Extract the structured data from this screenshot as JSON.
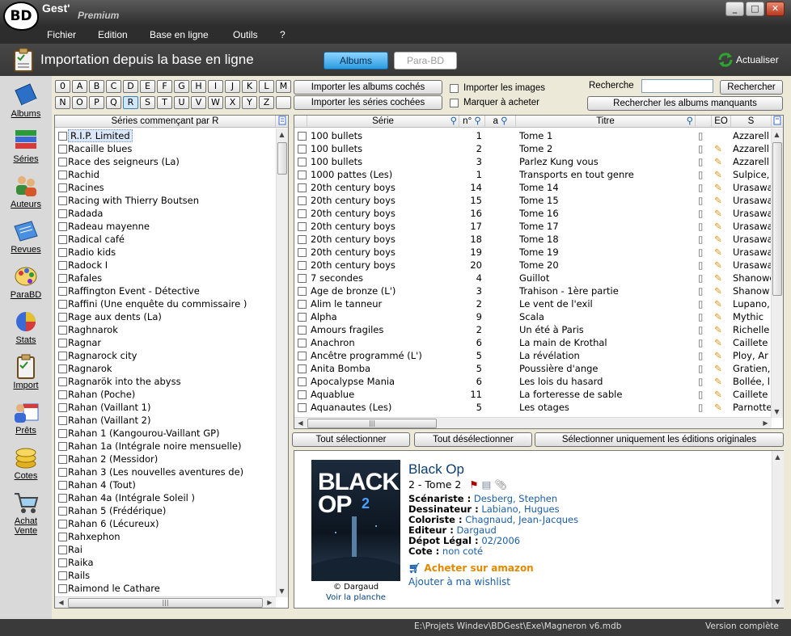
{
  "app": {
    "logo": "BD",
    "name": "Gest'",
    "edition": "Premium"
  },
  "window_buttons": [
    "minimize",
    "maximize",
    "close"
  ],
  "menu": [
    "Fichier",
    "Edition",
    "Base en ligne",
    "Outils",
    "?"
  ],
  "header": {
    "title": "Importation depuis la base en ligne",
    "tab_albums": "Albums",
    "tab_parabd": "Para-BD",
    "refresh": "Actualiser"
  },
  "sidebar": [
    {
      "label": "Albums",
      "icon": "book-icon"
    },
    {
      "label": "Séries",
      "icon": "books-stack-icon"
    },
    {
      "label": "Auteurs",
      "icon": "authors-icon"
    },
    {
      "label": "Revues",
      "icon": "magazine-icon"
    },
    {
      "label": "ParaBD",
      "icon": "palette-icon"
    },
    {
      "label": "Stats",
      "icon": "pie-chart-icon"
    },
    {
      "label": "Import",
      "icon": "clipboard-check-icon"
    },
    {
      "label": "Prêts",
      "icon": "calendar-person-icon"
    },
    {
      "label": "Cotes",
      "icon": "coins-icon"
    },
    {
      "label": "Achat\nVente",
      "icon": "shopping-cart-icon"
    }
  ],
  "letters_row1": [
    "0",
    "A",
    "B",
    "C",
    "D",
    "E",
    "F",
    "G",
    "H",
    "I",
    "J",
    "K",
    "L",
    "M"
  ],
  "letters_row2": [
    "N",
    "O",
    "P",
    "Q",
    "R",
    "S",
    "T",
    "U",
    "V",
    "W",
    "X",
    "Y",
    "Z",
    ""
  ],
  "active_letter": "R",
  "actions": {
    "import_albums": "Importer les albums cochés",
    "import_series": "Importer les séries cochées",
    "import_images": "Importer les images",
    "mark_to_buy": "Marquer à acheter",
    "search_label": "Recherche",
    "search_value": "",
    "search_button": "Rechercher",
    "search_missing": "Rechercher les albums manquants"
  },
  "series_panel": {
    "header": "Séries commençant par R",
    "items": [
      "R.I.P. Limited",
      "Racaille blues",
      "Race des seigneurs (La)",
      "Rachid",
      "Racines",
      "Racing with Thierry Boutsen",
      "Radada",
      "Radeau mayenne",
      "Radical café",
      "Radio kids",
      "Radock I",
      "Rafales",
      "Raffington Event - Détective",
      "Raffini (Une enquête du commissaire )",
      "Rage aux dents (La)",
      "Raghnarok",
      "Ragnar",
      "Ragnarock city",
      "Ragnarok",
      "Ragnarök into the abyss",
      "Rahan (Poche)",
      "Rahan (Vaillant 1)",
      "Rahan (Vaillant 2)",
      "Rahan 1 (Kangourou-Vaillant GP)",
      "Rahan 1a (Intégrale noire mensuelle)",
      "Rahan 2 (Messidor)",
      "Rahan 3 (Les nouvelles aventures de)",
      "Rahan 4 (Tout)",
      "Rahan 4a (Intégrale Soleil )",
      "Rahan 5 (Frédérique)",
      "Rahan 6 (Lécureux)",
      "Rahxephon",
      "Rai",
      "Raika",
      "Rails",
      "Raimond le Cathare"
    ]
  },
  "albums_panel": {
    "headers": {
      "serie": "Série",
      "num": "n°",
      "a": "a",
      "titre": "Titre",
      "eo": "EO",
      "s": "S"
    },
    "rows": [
      {
        "serie": "100 bullets",
        "num": "1",
        "titre": "Tome 1",
        "author": "Azzarell",
        "eo": false
      },
      {
        "serie": "100 bullets",
        "num": "2",
        "titre": "Tome 2",
        "author": "Azzarell",
        "eo": true
      },
      {
        "serie": "100 bullets",
        "num": "3",
        "titre": "Parlez Kung vous",
        "author": "Azzarell",
        "eo": true
      },
      {
        "serie": "1000 pattes (Les)",
        "num": "1",
        "titre": "Transports en tout genre",
        "author": "Sulpice,",
        "eo": true
      },
      {
        "serie": "20th century boys",
        "num": "14",
        "titre": "Tome 14",
        "author": "Urasawa",
        "eo": true
      },
      {
        "serie": "20th century boys",
        "num": "15",
        "titre": "Tome 15",
        "author": "Urasawa",
        "eo": true
      },
      {
        "serie": "20th century boys",
        "num": "16",
        "titre": "Tome 16",
        "author": "Urasawa",
        "eo": true
      },
      {
        "serie": "20th century boys",
        "num": "17",
        "titre": "Tome 17",
        "author": "Urasawa",
        "eo": true
      },
      {
        "serie": "20th century boys",
        "num": "18",
        "titre": "Tome 18",
        "author": "Urasawa",
        "eo": true
      },
      {
        "serie": "20th century boys",
        "num": "19",
        "titre": "Tome 19",
        "author": "Urasawa",
        "eo": true
      },
      {
        "serie": "20th century boys",
        "num": "20",
        "titre": "Tome 20",
        "author": "Urasawa",
        "eo": true
      },
      {
        "serie": "7 secondes",
        "num": "4",
        "titre": "Guillot",
        "author": "Shanower",
        "eo": true
      },
      {
        "serie": "Age de bronze (L')",
        "num": "3",
        "titre": "Trahison - 1ère partie",
        "author": "Shanow",
        "eo": true
      },
      {
        "serie": "Alim le tanneur",
        "num": "2",
        "titre": "Le vent de l'exil",
        "author": "Lupano,",
        "eo": true
      },
      {
        "serie": "Alpha",
        "num": "9",
        "titre": "Scala",
        "author": "Mythic",
        "eo": true
      },
      {
        "serie": "Amours fragiles",
        "num": "2",
        "titre": "Un été à Paris",
        "author": "Richelle",
        "eo": true
      },
      {
        "serie": "Anachron",
        "num": "6",
        "titre": "La main de Krothal",
        "author": "Caillete",
        "eo": true
      },
      {
        "serie": "Ancêtre programmé (L')",
        "num": "5",
        "titre": "La révélation",
        "author": "Ploy, Ar",
        "eo": true
      },
      {
        "serie": "Anita Bomba",
        "num": "5",
        "titre": "Poussière d'ange",
        "author": "Gratien,",
        "eo": true
      },
      {
        "serie": "Apocalypse Mania",
        "num": "6",
        "titre": "Les lois du hasard",
        "author": "Bollée, l",
        "eo": true
      },
      {
        "serie": "Aquablue",
        "num": "11",
        "titre": "La forteresse de sable",
        "author": "Caillete",
        "eo": true
      },
      {
        "serie": "Aquanautes (Les)",
        "num": "5",
        "titre": "Les otages",
        "author": "Parnotte",
        "eo": true
      }
    ]
  },
  "bottom_buttons": {
    "select_all": "Tout sélectionner",
    "deselect_all": "Tout désélectionner",
    "select_originals": "Sélectionner uniquement les éditions originales"
  },
  "detail": {
    "cover_title": "BLACK OP",
    "cover_num": "2",
    "publisher_credit": "© Dargaud",
    "see_page": "Voir la planche",
    "title": "Black Op",
    "subtitle": "2 - Tome 2",
    "scenariste_label": "Scénariste :",
    "scenariste": "Desberg, Stephen",
    "dessinateur_label": "Dessinateur :",
    "dessinateur": "Labiano, Hugues",
    "coloriste_label": "Coloriste :",
    "coloriste": "Chagnaud, Jean-Jacques",
    "editeur_label": "Editeur :",
    "editeur": "Dargaud",
    "depot_label": "Dépot Légal :",
    "depot": "02/2006",
    "cote_label": "Cote :",
    "cote": "non coté",
    "amazon": "Acheter sur amazon",
    "wishlist": "Ajouter à ma wishlist"
  },
  "status": {
    "path": "E:\\Projets Windev\\BDGest\\Exe\\Magneron v6.mdb",
    "version": "Version complète"
  },
  "colors": {
    "accent": "#2a9be0",
    "link": "#1a5ea8",
    "amazon": "#e08a00"
  }
}
